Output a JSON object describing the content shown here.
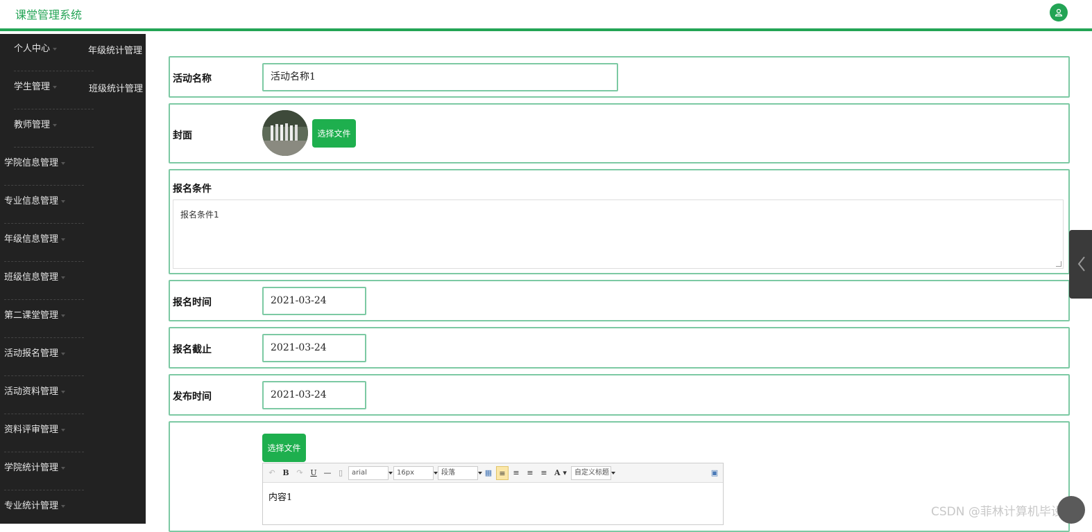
{
  "header": {
    "title": "课堂管理系统",
    "user_icon": "user-icon"
  },
  "sidebar": {
    "col1": [
      "个人中心",
      "学生管理",
      "教师管理",
      "学院信息管理",
      "专业信息管理",
      "年级信息管理",
      "班级信息管理",
      "第二课堂管理",
      "活动报名管理",
      "活动资料管理",
      "资料评审管理",
      "学院统计管理",
      "专业统计管理"
    ],
    "col2": [
      "年级统计管理",
      "班级统计管理"
    ]
  },
  "form": {
    "activity_name": {
      "label": "活动名称",
      "value": "活动名称1"
    },
    "cover": {
      "label": "封面",
      "button": "选择文件"
    },
    "conditions": {
      "label": "报名条件",
      "value": "报名条件1"
    },
    "signup_time": {
      "label": "报名时间",
      "value": "2021-03-24"
    },
    "signup_deadline": {
      "label": "报名截止",
      "value": "2021-03-24"
    },
    "publish_time": {
      "label": "发布时间",
      "value": "2021-03-24"
    },
    "content": {
      "button": "选择文件",
      "toolbar": {
        "font": "arial",
        "size": "16px",
        "paragraph": "段落",
        "custom_title": "自定义标题"
      },
      "value": "内容1"
    }
  },
  "watermark": "CSDN @菲林计算机毕设",
  "colors": {
    "accent": "#23a455",
    "button": "#1eaf4e",
    "border": "#7cc9a3",
    "sidebar_bg": "#222222"
  }
}
